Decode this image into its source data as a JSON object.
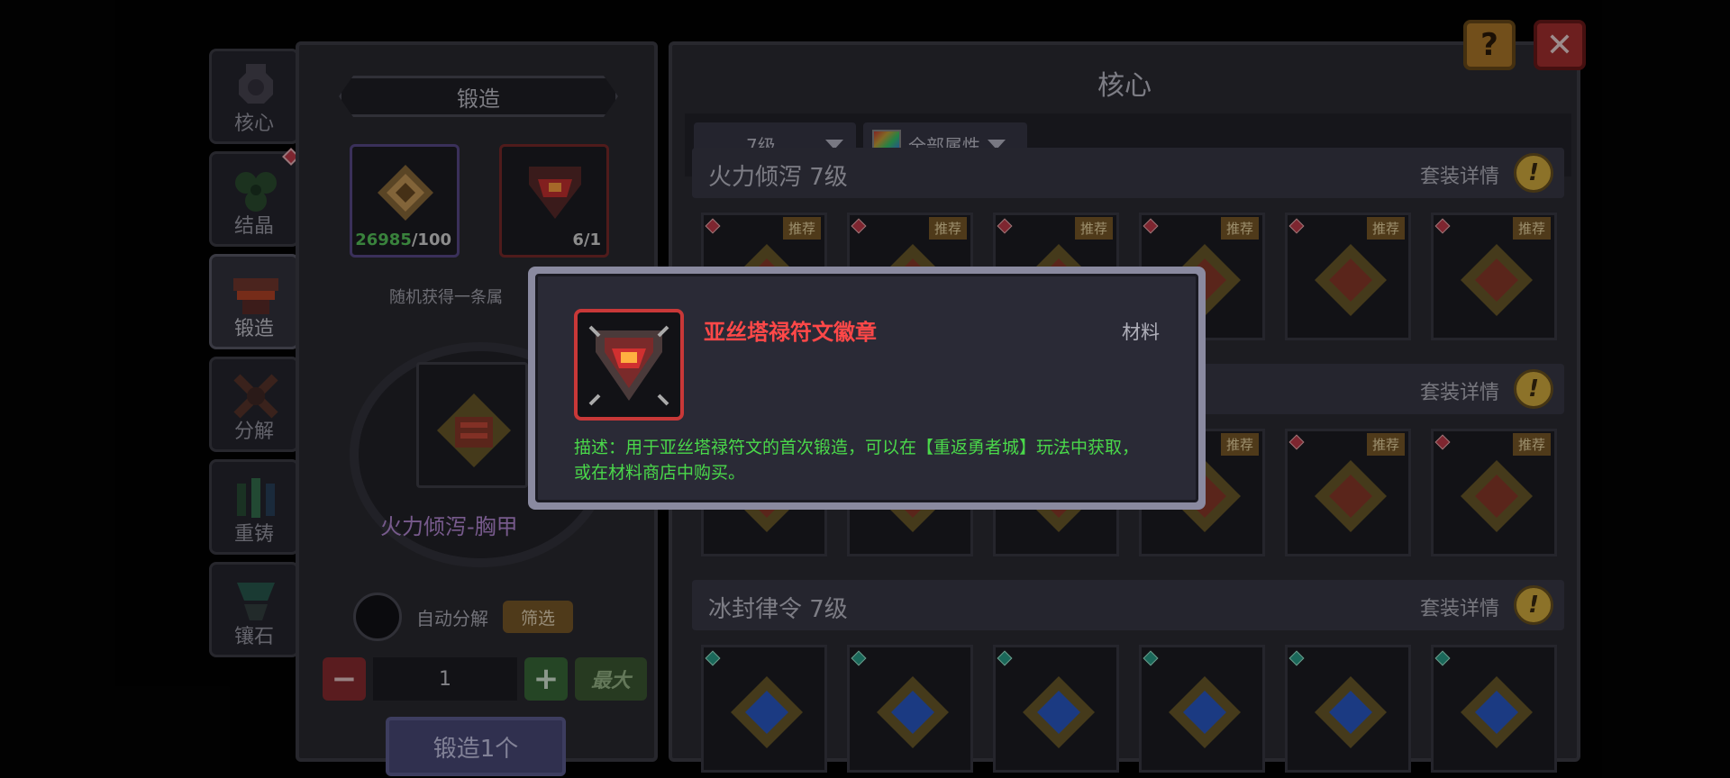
{
  "side_tabs": [
    {
      "label": "核心",
      "icon": "core-icon"
    },
    {
      "label": "结晶",
      "icon": "crystal-icon"
    },
    {
      "label": "锻造",
      "icon": "anvil-icon"
    },
    {
      "label": "分解",
      "icon": "disassemble-icon"
    },
    {
      "label": "重铸",
      "icon": "recast-icon"
    },
    {
      "label": "镶石",
      "icon": "gem-socket-icon"
    }
  ],
  "forge": {
    "title": "锻造",
    "material_1": {
      "have": "26985",
      "need": "/100"
    },
    "material_2": {
      "count": "6/1"
    },
    "info": "随机获得一条属",
    "result_tag": "推荐",
    "result_name": "火力倾泻-胸甲",
    "auto_label": "自动分解",
    "filter_label": "筛选",
    "minus": "−",
    "quantity": "1",
    "plus": "+",
    "max_label": "最大",
    "forge_button": "锻造1个"
  },
  "core": {
    "title": "核心",
    "level_filter": "7级",
    "attr_filter": "全部属性",
    "sections": [
      {
        "title": "火力倾泻 7级",
        "detail": "套装详情",
        "tag": "推荐",
        "gem": "red",
        "count": 6
      },
      {
        "title": "",
        "detail": "套装详情",
        "tag": "推荐",
        "gem": "red",
        "count": 6
      },
      {
        "title": "冰封律令 7级",
        "detail": "套装详情",
        "tag": "",
        "gem": "teal",
        "count": 6
      }
    ]
  },
  "buttons": {
    "help": "?",
    "close": "✕"
  },
  "tooltip": {
    "name": "亚丝塔禄符文徽章",
    "type": "材料",
    "description": "描述：用于亚丝塔禄符文的首次锻造，可以在【重返勇者城】玩法中获取，或在材料商店中购买。"
  },
  "colors": {
    "tooltip_name": "#ff4848",
    "tooltip_desc": "#4ad84a",
    "result_name": "#b78ad8",
    "recommend_tag": "#7a5a28",
    "close_button": "#a83030",
    "help_button": "#b07a2a"
  }
}
